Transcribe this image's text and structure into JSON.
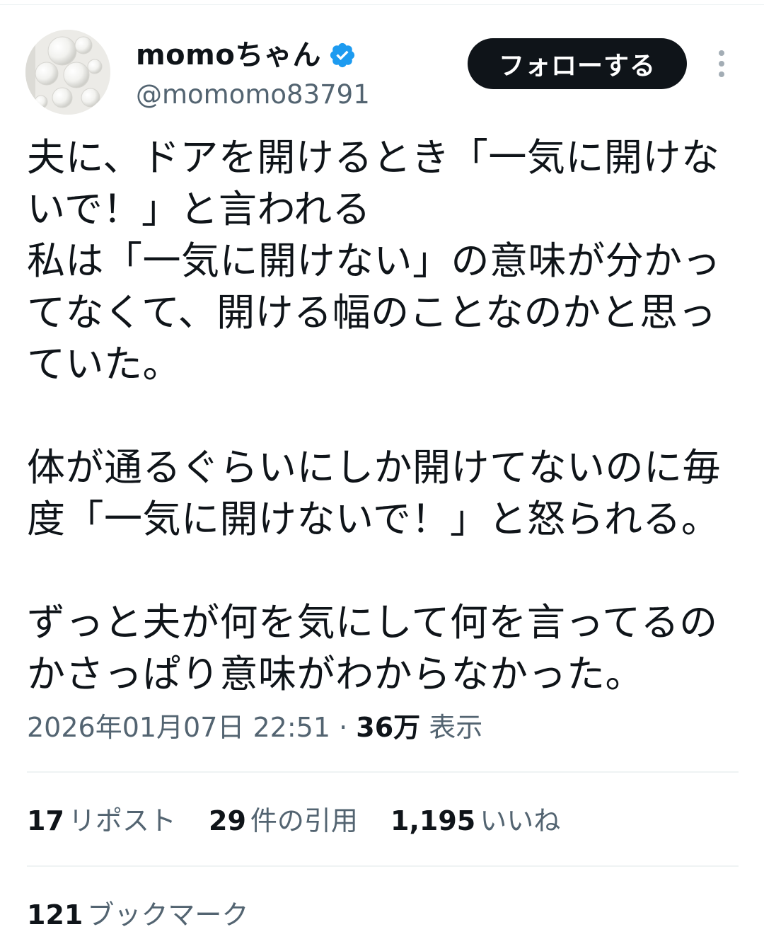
{
  "user": {
    "display_name": "momoちゃん",
    "handle": "@momomo83791",
    "verified": true,
    "verified_color": "#1d9bf0"
  },
  "follow_button": {
    "label": "フォローする"
  },
  "tweet": {
    "paragraphs": [
      "夫に、ドアを開けるとき「一気に開けないで！」と言われる\n私は「一気に開けない」の意味が分かってなくて、開ける幅のことなのかと思っていた。",
      "体が通るぐらいにしか開けてないのに毎度「一気に開けないで！」と怒られる。",
      "ずっと夫が何を気にして何を言ってるのかさっぱり意味がわからなかった。"
    ]
  },
  "meta": {
    "datetime": "2026年01月07日 22:51",
    "separator": "·",
    "views_count": "36万",
    "views_label": "表示"
  },
  "stats": {
    "reposts": {
      "count": "17",
      "label": "リポスト"
    },
    "quotes": {
      "count": "29",
      "label": "件の引用"
    },
    "likes": {
      "count": "1,195",
      "label": "いいね"
    },
    "bookmarks": {
      "count": "121",
      "label": "ブックマーク"
    }
  },
  "colors": {
    "text_primary": "#0f1419",
    "text_secondary": "#536471",
    "divider": "#eff3f4",
    "button_bg": "#0f1419",
    "button_text": "#ffffff"
  }
}
